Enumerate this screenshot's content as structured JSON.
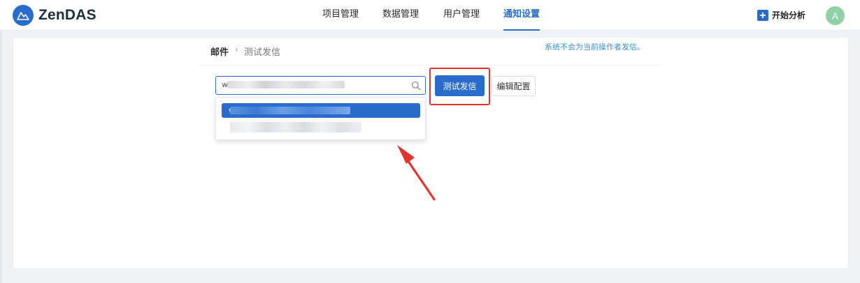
{
  "app": {
    "brand": "ZenDAS"
  },
  "nav": {
    "items": [
      {
        "label": "项目管理",
        "active": false
      },
      {
        "label": "数据管理",
        "active": false
      },
      {
        "label": "用户管理",
        "active": false
      },
      {
        "label": "通知设置",
        "active": true
      }
    ]
  },
  "header": {
    "start_label": "开始分析",
    "avatar_letter": "A"
  },
  "breadcrumb": {
    "root": "邮件",
    "separator": "›",
    "current": "测试发信"
  },
  "notice": "系统不会为当前操作者发信。",
  "search": {
    "value_prefix": "w",
    "icon": "search-icon"
  },
  "dropdown": {
    "selected_prefix": "w"
  },
  "buttons": {
    "test_send": "测试发信",
    "edit_config": "编辑配置"
  },
  "colors": {
    "accent": "#2a6ccb",
    "highlight": "#e0342f",
    "notice": "#3d8fd1"
  }
}
